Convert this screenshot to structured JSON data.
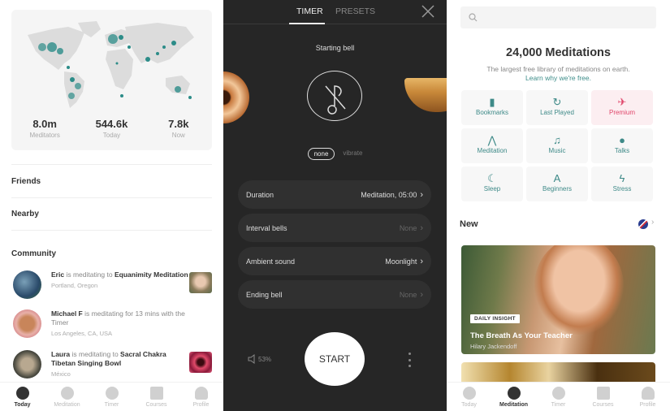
{
  "today": {
    "stats": [
      {
        "value": "8.0m",
        "label": "Meditators"
      },
      {
        "value": "544.6k",
        "label": "Today"
      },
      {
        "value": "7.8k",
        "label": "Now"
      }
    ],
    "links": [
      "Friends",
      "Nearby"
    ],
    "community_title": "Community",
    "community": [
      {
        "name": "Eric",
        "action": " is meditating to ",
        "target": "Equanimity Meditation",
        "location": "Portland, Oregon",
        "has_thumb": true
      },
      {
        "name": "Michael F",
        "action": " is meditating for 13 mins with the Timer",
        "target": "",
        "location": "Los Angeles, CA, USA",
        "has_thumb": false
      },
      {
        "name": "Laura",
        "action": " is meditating to ",
        "target": "Sacral Chakra Tibetan Singing Bowl",
        "location": "México",
        "has_thumb": true
      }
    ],
    "tabs": [
      "Today",
      "Meditation",
      "Timer",
      "Courses",
      "Profile"
    ],
    "active_tab": "Today"
  },
  "timer": {
    "tabs": [
      "TIMER",
      "PRESETS"
    ],
    "active_tab": "TIMER",
    "starting_bell_label": "Starting bell",
    "vibrate_options": [
      "none",
      "vibrate"
    ],
    "selected_vibrate": "none",
    "settings": [
      {
        "key": "Duration",
        "value": "Meditation, 05:00",
        "dim": false
      },
      {
        "key": "Interval bells",
        "value": "None",
        "dim": true
      },
      {
        "key": "Ambient sound",
        "value": "Moonlight",
        "dim": false
      },
      {
        "key": "Ending bell",
        "value": "None",
        "dim": true
      }
    ],
    "volume": "53%",
    "start_label": "START"
  },
  "library": {
    "search_placeholder": "",
    "title": "24,000 Meditations",
    "subtitle": "The largest free library of meditations on earth.",
    "link": "Learn why we're free.",
    "categories": [
      {
        "label": "Bookmarks",
        "icon": "bookmark-icon",
        "glyph": "▮"
      },
      {
        "label": "Last Played",
        "icon": "replay-icon",
        "glyph": "↻"
      },
      {
        "label": "Premium",
        "icon": "bird-icon",
        "glyph": "✈"
      },
      {
        "label": "Meditation",
        "icon": "hands-icon",
        "glyph": "⋀"
      },
      {
        "label": "Music",
        "icon": "music-note-icon",
        "glyph": "♫"
      },
      {
        "label": "Talks",
        "icon": "microphone-icon",
        "glyph": "🎙"
      },
      {
        "label": "Sleep",
        "icon": "moon-icon",
        "glyph": "☾"
      },
      {
        "label": "Beginners",
        "icon": "letter-a-icon",
        "glyph": "A"
      },
      {
        "label": "Stress",
        "icon": "lightning-icon",
        "glyph": "⚡"
      }
    ],
    "new_title": "New",
    "featured": {
      "badge": "DAILY INSIGHT",
      "title": "The Breath As Your Teacher",
      "author": "Hilary Jackendoff"
    },
    "tabs": [
      "Today",
      "Meditation",
      "Timer",
      "Courses",
      "Profile"
    ],
    "active_tab": "Meditation",
    "accent": "#3e8a88",
    "premium_color": "#e0456a"
  }
}
